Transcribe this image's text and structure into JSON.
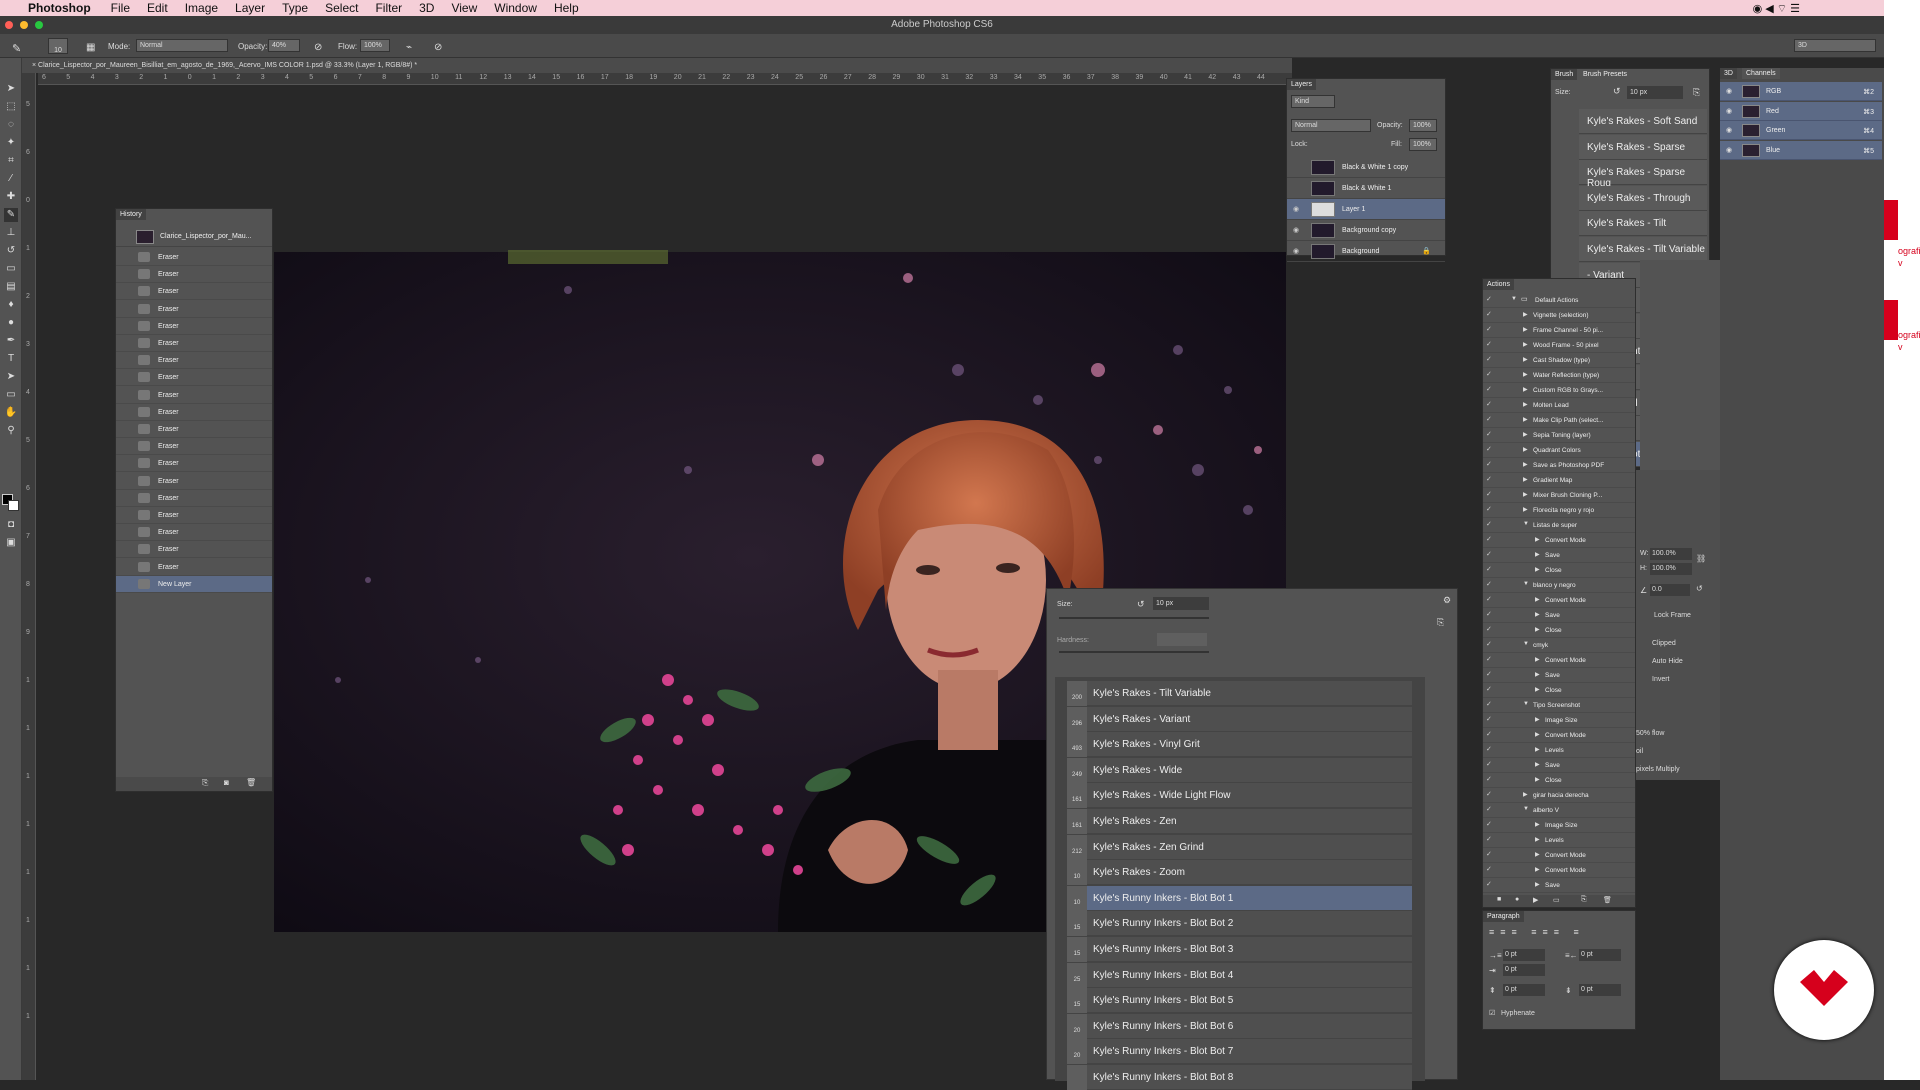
{
  "menubar": {
    "apple": "",
    "app": "Photoshop",
    "items": [
      "File",
      "Edit",
      "Image",
      "Layer",
      "Type",
      "Select",
      "Filter",
      "3D",
      "View",
      "Window",
      "Help"
    ]
  },
  "window": {
    "title": "Adobe Photoshop CS6"
  },
  "options": {
    "mode_label": "Mode:",
    "mode_value": "Normal",
    "opacity_label": "Opacity:",
    "opacity_value": "40%",
    "flow_label": "Flow:",
    "flow_value": "100%",
    "brush_size": "10",
    "workspace": "3D"
  },
  "document": {
    "tab": "Clarice_Lispector_por_Maureen_Bisilliat_em_agosto_de_1969,_Acervo_IMS COLOR 1.psd @ 33.3% (Layer 1, RGB/8#) *"
  },
  "ruler_h": [
    "6",
    "5",
    "4",
    "3",
    "2",
    "1",
    "0",
    "1",
    "2",
    "3",
    "4",
    "5",
    "6",
    "7",
    "8",
    "9",
    "10",
    "11",
    "12",
    "13",
    "14",
    "15",
    "16",
    "17",
    "18",
    "19",
    "20",
    "21",
    "22",
    "23",
    "24",
    "25",
    "26",
    "27",
    "28",
    "29",
    "30",
    "31",
    "32",
    "33",
    "34",
    "35",
    "36",
    "37",
    "38",
    "39",
    "40",
    "41",
    "42",
    "43",
    "44"
  ],
  "ruler_v": [
    "5",
    "6",
    "0",
    "1",
    "2",
    "3",
    "4",
    "5",
    "6",
    "7",
    "8",
    "9",
    "1",
    "1",
    "1",
    "1",
    "1",
    "1",
    "1",
    "1"
  ],
  "history": {
    "title": "History",
    "snapshot": "Clarice_Lispector_por_Mau...",
    "items": [
      "Eraser",
      "Eraser",
      "Eraser",
      "Eraser",
      "Eraser",
      "Eraser",
      "Eraser",
      "Eraser",
      "Eraser",
      "Eraser",
      "Eraser",
      "Eraser",
      "Eraser",
      "Eraser",
      "Eraser",
      "Eraser",
      "Eraser",
      "Eraser",
      "Eraser",
      "New Layer"
    ]
  },
  "layers": {
    "title": "Layers",
    "kind": "Kind",
    "blend": "Normal",
    "opacity_label": "Opacity:",
    "opacity": "100%",
    "lock_label": "Lock:",
    "fill_label": "Fill:",
    "fill": "100%",
    "items": [
      "Black & White 1 copy",
      "Black & White 1",
      "Layer 1",
      "Background copy",
      "Background"
    ]
  },
  "brush_popup": {
    "size_label": "Size:",
    "size_value": "10 px",
    "hardness_label": "Hardness:",
    "items": [
      {
        "label": "Kyle's Rakes - Tilt Variable",
        "num": "200"
      },
      {
        "label": "Kyle's Rakes - Variant",
        "num": "296"
      },
      {
        "label": "Kyle's Rakes - Vinyl Grit",
        "num": "493"
      },
      {
        "label": "Kyle's Rakes - Wide",
        "num": "249"
      },
      {
        "label": "Kyle's Rakes - Wide Light Flow",
        "num": "161"
      },
      {
        "label": "Kyle's Rakes - Zen",
        "num": "161"
      },
      {
        "label": "Kyle's Rakes - Zen Grind",
        "num": "212"
      },
      {
        "label": "Kyle's Rakes - Zoom",
        "num": "10"
      },
      {
        "label": "Kyle's Runny Inkers - Blot Bot 1",
        "num": "10"
      },
      {
        "label": "Kyle's Runny Inkers - Blot Bot 2",
        "num": "15"
      },
      {
        "label": "Kyle's Runny Inkers - Blot Bot 3",
        "num": "15"
      },
      {
        "label": "Kyle's Runny Inkers - Blot Bot 4",
        "num": "25"
      },
      {
        "label": "Kyle's Runny Inkers - Blot Bot 5",
        "num": "15"
      },
      {
        "label": "Kyle's Runny Inkers - Blot Bot 6",
        "num": "20"
      },
      {
        "label": "Kyle's Runny Inkers - Blot Bot 7",
        "num": "20"
      },
      {
        "label": "Kyle's Runny Inkers - Blot Bot 8",
        "num": ""
      }
    ]
  },
  "brush_presets": {
    "tab1": "Brush",
    "tab2": "Brush Presets",
    "size_label": "Size:",
    "size_value": "10 px",
    "items": [
      "Kyle's Rakes - Soft Sand",
      "Kyle's Rakes - Sparse",
      "Kyle's Rakes - Sparse Roug",
      "Kyle's Rakes - Through",
      "Kyle's Rakes - Tilt",
      "Kyle's Rakes - Tilt Variable",
      "- Variant",
      "- Vinyl Grit",
      "- Wide",
      "- Wide Light Fl",
      "- Zen",
      "- Zen Grind",
      "- Zoom",
      "Inkers - Blot B"
    ]
  },
  "actions": {
    "title": "Actions",
    "items": [
      {
        "t": "Default Actions",
        "lvl": 0
      },
      {
        "t": "Vignette (selection)",
        "lvl": 1
      },
      {
        "t": "Frame Channel - 50 pi...",
        "lvl": 1
      },
      {
        "t": "Wood Frame - 50 pixel",
        "lvl": 1
      },
      {
        "t": "Cast Shadow (type)",
        "lvl": 1
      },
      {
        "t": "Water Reflection (type)",
        "lvl": 1
      },
      {
        "t": "Custom RGB to Grays...",
        "lvl": 1
      },
      {
        "t": "Molten Lead",
        "lvl": 1
      },
      {
        "t": "Make Clip Path (select...",
        "lvl": 1
      },
      {
        "t": "Sepia Toning (layer)",
        "lvl": 1
      },
      {
        "t": "Quadrant Colors",
        "lvl": 1
      },
      {
        "t": "Save as Photoshop PDF",
        "lvl": 1
      },
      {
        "t": "Gradient Map",
        "lvl": 1
      },
      {
        "t": "Mixer Brush Cloning P...",
        "lvl": 1
      },
      {
        "t": "Florecita negro y rojo",
        "lvl": 1
      },
      {
        "t": "Listas de super",
        "lvl": 1
      },
      {
        "t": "Convert Mode",
        "lvl": 2
      },
      {
        "t": "Save",
        "lvl": 2
      },
      {
        "t": "Close",
        "lvl": 2
      },
      {
        "t": "blanco y negro",
        "lvl": 1
      },
      {
        "t": "Convert Mode",
        "lvl": 2
      },
      {
        "t": "Save",
        "lvl": 2
      },
      {
        "t": "Close",
        "lvl": 2
      },
      {
        "t": "cmyk",
        "lvl": 1
      },
      {
        "t": "Convert Mode",
        "lvl": 2
      },
      {
        "t": "Save",
        "lvl": 2
      },
      {
        "t": "Close",
        "lvl": 2
      },
      {
        "t": "Tipo Screenshot",
        "lvl": 1
      },
      {
        "t": "Image Size",
        "lvl": 2
      },
      {
        "t": "Convert Mode",
        "lvl": 2
      },
      {
        "t": "Levels",
        "lvl": 2
      },
      {
        "t": "Save",
        "lvl": 2
      },
      {
        "t": "Close",
        "lvl": 2
      },
      {
        "t": "girar hacia derecha",
        "lvl": 1
      },
      {
        "t": "alberto V",
        "lvl": 1
      },
      {
        "t": "Image Size",
        "lvl": 2
      },
      {
        "t": "Levels",
        "lvl": 2
      },
      {
        "t": "Convert Mode",
        "lvl": 2
      },
      {
        "t": "Convert Mode",
        "lvl": 2
      },
      {
        "t": "Save",
        "lvl": 2
      }
    ]
  },
  "paragraph": {
    "title": "Paragraph",
    "v1": "0 pt",
    "v2": "0 pt",
    "v3": "0 pt",
    "v4": "0 pt",
    "v5": "0 pt",
    "hyphenate": "Hyphenate"
  },
  "properties": {
    "w_label": "W:",
    "w": "100.0%",
    "h_label": "H:",
    "h": "100.0%",
    "angle": "0.0",
    "lock_frame": "Lock Frame",
    "clipped": "Clipped",
    "auto_hide": "Auto Hide",
    "invert": "Invert",
    "flow": "50% flow",
    "oil": "oil",
    "multiply": "pixels Multiply"
  },
  "channels": {
    "tab1": "3D",
    "tab2": "Channels",
    "items": [
      {
        "name": "RGB",
        "key": "⌘2"
      },
      {
        "name": "Red",
        "key": "⌘3"
      },
      {
        "name": "Green",
        "key": "⌘4"
      },
      {
        "name": "Blue",
        "key": "⌘5"
      }
    ]
  },
  "edge_text": [
    "ografia",
    "v",
    "ografia",
    "v"
  ],
  "colors": {
    "accent_selection": "#5c6a86",
    "brand_red": "#d6001c"
  }
}
